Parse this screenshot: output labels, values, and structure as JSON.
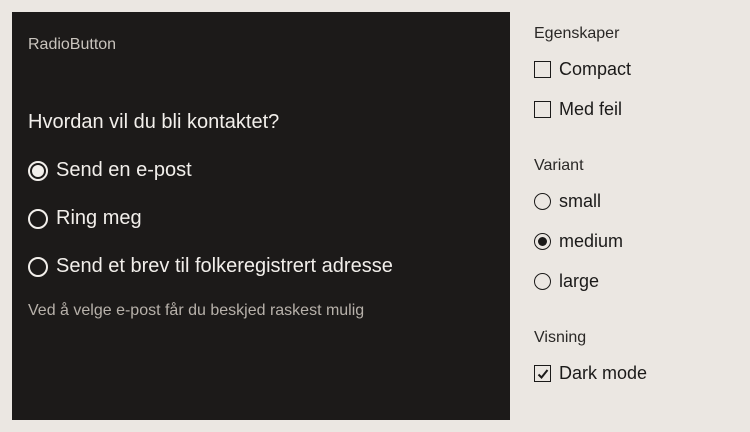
{
  "preview": {
    "component_name": "RadioButton",
    "question": "Hvordan vil du bli kontaktet?",
    "options": [
      {
        "label": "Send en e-post",
        "selected": true
      },
      {
        "label": "Ring meg",
        "selected": false
      },
      {
        "label": "Send et brev til folkeregistrert adresse",
        "selected": false
      }
    ],
    "helper_text": "Ved å velge e-post får du beskjed raskest mulig"
  },
  "panel": {
    "properties": {
      "label": "Egenskaper",
      "items": [
        {
          "label": "Compact",
          "checked": false
        },
        {
          "label": "Med feil",
          "checked": false
        }
      ]
    },
    "variant": {
      "label": "Variant",
      "items": [
        {
          "label": "small",
          "selected": false
        },
        {
          "label": "medium",
          "selected": true
        },
        {
          "label": "large",
          "selected": false
        }
      ]
    },
    "display": {
      "label": "Visning",
      "items": [
        {
          "label": "Dark mode",
          "checked": true
        }
      ]
    }
  }
}
